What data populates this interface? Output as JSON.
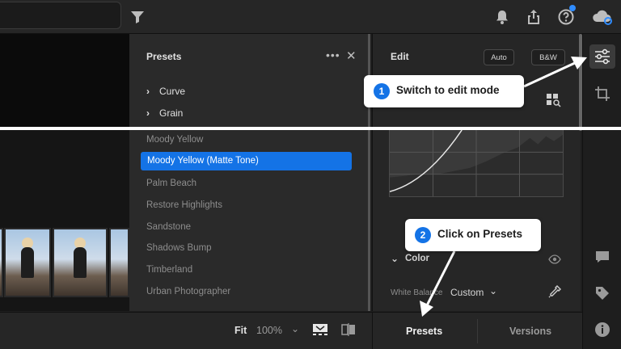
{
  "topbar": {
    "icons": [
      "filter-icon",
      "bell-icon",
      "share-icon",
      "help-icon",
      "cloud-sync-icon"
    ]
  },
  "presets_panel": {
    "title": "Presets",
    "more": "•••",
    "close": "✕",
    "groups": [
      {
        "label": "Curve"
      },
      {
        "label": "Grain"
      }
    ],
    "items": [
      {
        "label": "Moody Yellow"
      },
      {
        "label": "Moody Yellow (Matte Tone)",
        "selected": true
      },
      {
        "label": "Palm Beach"
      },
      {
        "label": "Restore Highlights"
      },
      {
        "label": "Sandstone"
      },
      {
        "label": "Shadows Bump"
      },
      {
        "label": "Timberland"
      },
      {
        "label": "Urban Photographer"
      }
    ]
  },
  "edit_panel": {
    "title": "Edit",
    "auto_label": "Auto",
    "bw_label": "B&W",
    "color_label": "Color",
    "white_balance_label": "White Balance",
    "white_balance_value": "Custom"
  },
  "bottombar": {
    "fit_label": "Fit",
    "zoom_value": "100%"
  },
  "bottom_tabs": {
    "presets": "Presets",
    "versions": "Versions"
  },
  "annotations": {
    "step1_num": "1",
    "step1_text": "Switch to edit mode",
    "step2_num": "2",
    "step2_text": "Click on Presets"
  },
  "colors": {
    "accent": "#1473e6",
    "panel_bg": "#2a2a2a",
    "app_bg": "#1e1e1e"
  }
}
